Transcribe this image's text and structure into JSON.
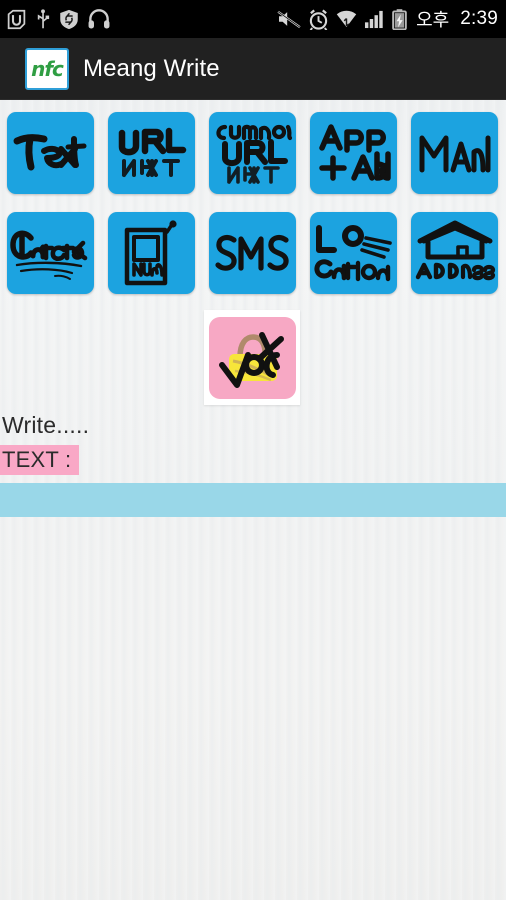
{
  "status_bar": {
    "left_icons": [
      {
        "name": "u-plus-app-icon",
        "label": "U+"
      },
      {
        "name": "usb-icon",
        "label": "USB"
      },
      {
        "name": "shield-sync-icon",
        "label": "Shield"
      },
      {
        "name": "headphones-icon",
        "label": "Headphones"
      }
    ],
    "right_icons": [
      {
        "name": "mute-icon",
        "label": "Mute"
      },
      {
        "name": "alarm-icon",
        "label": "Alarm"
      },
      {
        "name": "wifi-icon",
        "label": "Wi-Fi"
      },
      {
        "name": "signal-icon",
        "label": "Signal"
      },
      {
        "name": "battery-charging-icon",
        "label": "Battery charging"
      }
    ],
    "ampm": "오후",
    "clock": "2:39"
  },
  "action_bar": {
    "logo_text": "nfc",
    "logo_icon": "nfc-logo-icon",
    "title": "Meang Write"
  },
  "tiles": {
    "row1": [
      {
        "id": "text",
        "label": "Text",
        "icon": "text-tile-icon",
        "color": "#1ca3e0"
      },
      {
        "id": "url",
        "label": "URL",
        "icon": "url-tile-icon",
        "color": "#1ca3e0"
      },
      {
        "id": "custom-url",
        "label": "Custom URL",
        "icon": "custom-url-tile-icon",
        "color": "#1ca3e0"
      },
      {
        "id": "app-add",
        "label": "App + Add",
        "icon": "app-add-tile-icon",
        "color": "#1ca3e0"
      },
      {
        "id": "mail",
        "label": "Mail",
        "icon": "mail-tile-icon",
        "color": "#1ca3e0"
      }
    ],
    "row2": [
      {
        "id": "contact",
        "label": "Contact",
        "icon": "contact-tile-icon",
        "color": "#1ca3e0"
      },
      {
        "id": "number",
        "label": "NuM",
        "icon": "phone-number-tile-icon",
        "color": "#1ca3e0"
      },
      {
        "id": "sms",
        "label": "SMS",
        "icon": "sms-tile-icon",
        "color": "#1ca3e0"
      },
      {
        "id": "location",
        "label": "Location",
        "icon": "location-tile-icon",
        "color": "#1ca3e0"
      },
      {
        "id": "address",
        "label": "Address",
        "icon": "address-tile-icon",
        "color": "#1ca3e0"
      }
    ],
    "lock": {
      "id": "lock",
      "label": "Lock",
      "icon": "lock-tile-icon",
      "color": "#f7a8c4"
    }
  },
  "form": {
    "write_label": "Write.....",
    "text_label": "TEXT :",
    "text_value": "",
    "text_placeholder": ""
  },
  "colors": {
    "tile_blue": "#1ca3e0",
    "lock_pink": "#f7a8c4",
    "label_pink": "#f9a8c6",
    "input_blue": "#99d7e8",
    "action_bar": "#212121",
    "status_bar": "#000000",
    "logo_green": "#2f9e43"
  }
}
